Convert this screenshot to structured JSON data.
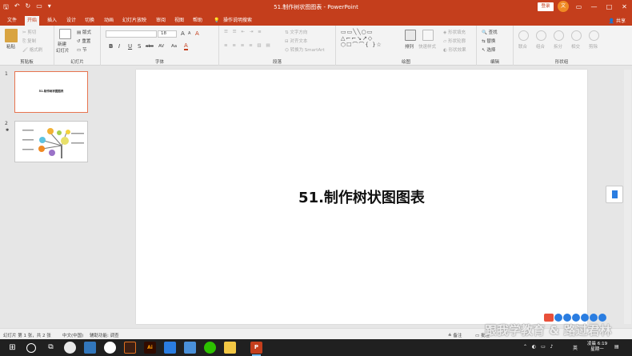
{
  "window": {
    "title": "51.制作树状图图表 - PowerPoint",
    "login_label": "登录",
    "avatar_text": "文",
    "share_label": "共享",
    "quick_access": {
      "save": "🖫",
      "undo": "↶",
      "redo": "↻",
      "present": "▭",
      "customize": "▾"
    },
    "controls": {
      "restore": "▭",
      "minimize": "—",
      "maximize": "□",
      "close": "✕"
    }
  },
  "tabs": [
    {
      "label": "文件",
      "active": false
    },
    {
      "label": "开始",
      "active": true
    },
    {
      "label": "插入",
      "active": false
    },
    {
      "label": "设计",
      "active": false
    },
    {
      "label": "切换",
      "active": false
    },
    {
      "label": "动画",
      "active": false
    },
    {
      "label": "幻灯片放映",
      "active": false
    },
    {
      "label": "审阅",
      "active": false
    },
    {
      "label": "视图",
      "active": false
    },
    {
      "label": "帮助",
      "active": false
    }
  ],
  "tell_me": "操作说明搜索",
  "ribbon": {
    "clipboard": {
      "label": "剪贴板",
      "paste": "粘贴",
      "cut": "剪切",
      "copy": "复制",
      "format_painter": "格式刷"
    },
    "slides": {
      "label": "幻灯片",
      "new_slide": "新建",
      "new_slide2": "幻灯片",
      "layout": "版式",
      "reset": "重置",
      "section": "节"
    },
    "font": {
      "label": "字体",
      "size": "18",
      "bold": "B",
      "italic": "I",
      "underline": "U",
      "strike": "S",
      "shadow": "abc",
      "spacing": "AV",
      "case": "Aa",
      "grow": "A",
      "shrink": "A",
      "clear": "A",
      "color": "A"
    },
    "paragraph": {
      "label": "段落",
      "text_direction": "文字方向",
      "align_text": "对齐文本",
      "smartart": "转换为 SmartArt"
    },
    "drawing": {
      "label": "绘图",
      "arrange": "排列",
      "quick_styles": "快速样式",
      "shape_fill": "形状填充",
      "shape_outline": "形状轮廓",
      "shape_effects": "形状效果"
    },
    "editing": {
      "label": "编辑",
      "find": "查找",
      "replace": "替换",
      "select": "选择"
    },
    "shape_group": {
      "label": "形状组",
      "items": [
        "联合",
        "组合",
        "拆分",
        "相交",
        "剪除"
      ]
    }
  },
  "thumbnails": [
    {
      "number": "1",
      "title": "51.制作树状图图表",
      "selected": true
    },
    {
      "number": "2",
      "title": "",
      "selected": false
    }
  ],
  "slide": {
    "title": "51.制作树状图图表"
  },
  "status": {
    "slide_info": "幻灯片 第 1 张，共 2 张",
    "language": "中文(中国)",
    "accessibility": "辅助功能: 调查",
    "notes": "备注",
    "comments": "批注"
  },
  "ime": {
    "label": "S",
    "mode": "英"
  },
  "watermark": "跟我学教育 & 路过君林",
  "clock": {
    "time": "6:19",
    "day": "星期一",
    "weather": "凌晨"
  },
  "tray_lang": "英",
  "colors": {
    "accent": "#c43e1c",
    "selection": "#e8744f"
  }
}
